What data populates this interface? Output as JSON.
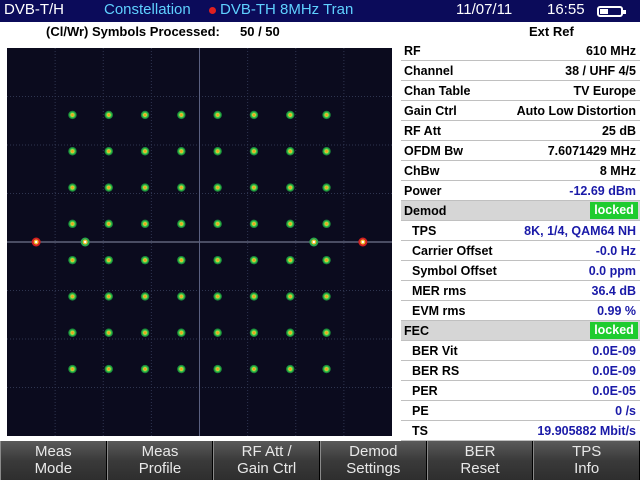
{
  "titlebar": {
    "mode": "DVB-T/H",
    "measurement": "Constellation",
    "standard": "DVB-TH 8MHz Tran",
    "date": "11/07/11",
    "time": "16:55"
  },
  "inforow": {
    "label": "(Cl/Wr) Symbols Processed:",
    "value": "50 / 50",
    "reference": "Ext Ref"
  },
  "colors": {
    "title_bg": "#0b0b5a",
    "title_accent": "#5fd0ff",
    "plot_bg": "#0b0b1e",
    "grid": "#2f3550",
    "locked": "#1fcc2f",
    "value_blue": "#1a1aa8"
  },
  "params": [
    {
      "key": "RF",
      "value": "610 MHz"
    },
    {
      "key": "Channel",
      "value": "38 / UHF 4/5"
    },
    {
      "key": "Chan Table",
      "value": "TV Europe"
    },
    {
      "key": "Gain Ctrl",
      "value": "Auto Low Distortion"
    },
    {
      "key": "RF Att",
      "value": "25 dB"
    },
    {
      "key": "OFDM Bw",
      "value": "7.6071429 MHz"
    },
    {
      "key": "ChBw",
      "value": "8 MHz"
    },
    {
      "key": "Power",
      "value": "-12.69 dBm"
    }
  ],
  "demod": {
    "title": "Demod",
    "status": "locked",
    "rows": [
      {
        "key": "TPS",
        "value": "8K, 1/4, QAM64 NH"
      },
      {
        "key": "Carrier Offset",
        "value": "-0.0 Hz"
      },
      {
        "key": "Symbol Offset",
        "value": "0.0 ppm"
      },
      {
        "key": "MER rms",
        "value": "36.4 dB"
      },
      {
        "key": "EVM rms",
        "value": "0.99 %"
      }
    ]
  },
  "fec": {
    "title": "FEC",
    "status": "locked",
    "rows": [
      {
        "key": "BER Vit",
        "value": "0.0E-09"
      },
      {
        "key": "BER RS",
        "value": "0.0E-09"
      },
      {
        "key": "PER",
        "value": "0.0E-05"
      },
      {
        "key": "PE",
        "value": "0 /s"
      },
      {
        "key": "TS",
        "value": "19.905882 Mbit/s"
      }
    ]
  },
  "softkeys": [
    {
      "line1": "Meas",
      "line2": "Mode"
    },
    {
      "line1": "Meas",
      "line2": "Profile"
    },
    {
      "line1": "RF Att /",
      "line2": "Gain Ctrl"
    },
    {
      "line1": "Demod",
      "line2": "Settings"
    },
    {
      "line1": "BER",
      "line2": "Reset"
    },
    {
      "line1": "TPS",
      "line2": "Info"
    }
  ]
}
